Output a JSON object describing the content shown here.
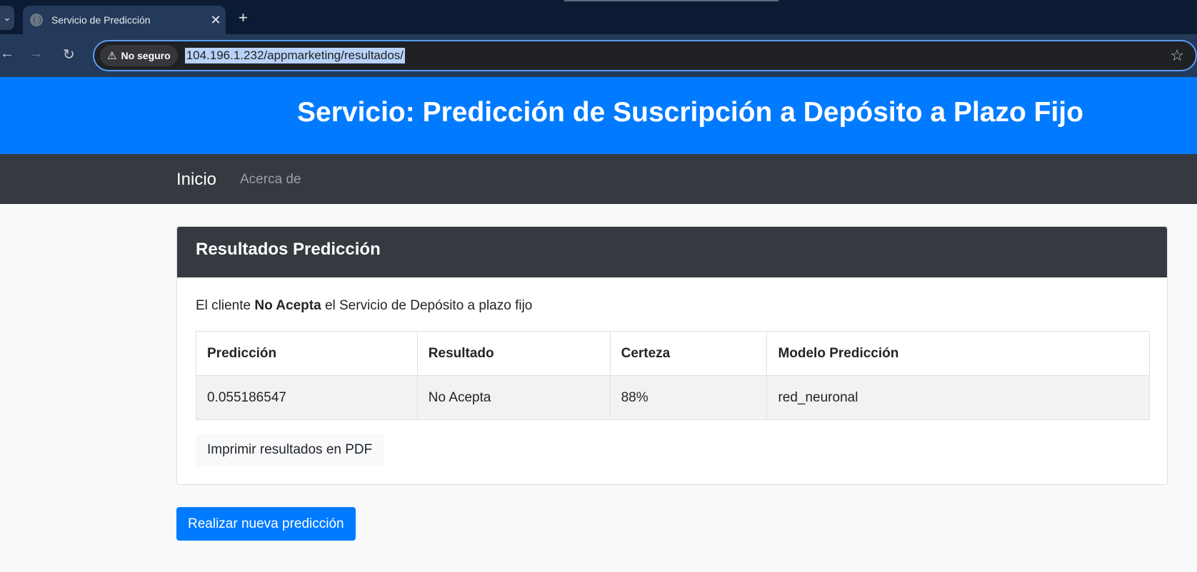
{
  "browser": {
    "tab_title": "Servicio de Predicción",
    "tab_menu_icon": "chevron-down-icon",
    "security_label": "No seguro",
    "url": "104.196.1.232/appmarketing/resultados/"
  },
  "header": {
    "title": "Servicio: Predicción de Suscripción a Depósito a Plazo Fijo"
  },
  "nav": {
    "home": "Inicio",
    "about": "Acerca de"
  },
  "card": {
    "title": "Resultados Predicción",
    "message_prefix": "El cliente",
    "message_bold": "No Acepta",
    "message_suffix": "el Servicio de Depósito a plazo fijo",
    "table": {
      "headers": [
        "Predicción",
        "Resultado",
        "Certeza",
        "Modelo Predicción"
      ],
      "rows": [
        [
          "0.055186547",
          "No Acepta",
          "88%",
          "red_neuronal"
        ]
      ]
    },
    "pdf_button": "Imprimir resultados en PDF"
  },
  "new_prediction_button": "Realizar nueva predicción",
  "colors": {
    "primary": "#007bff",
    "dark": "#343a40"
  }
}
